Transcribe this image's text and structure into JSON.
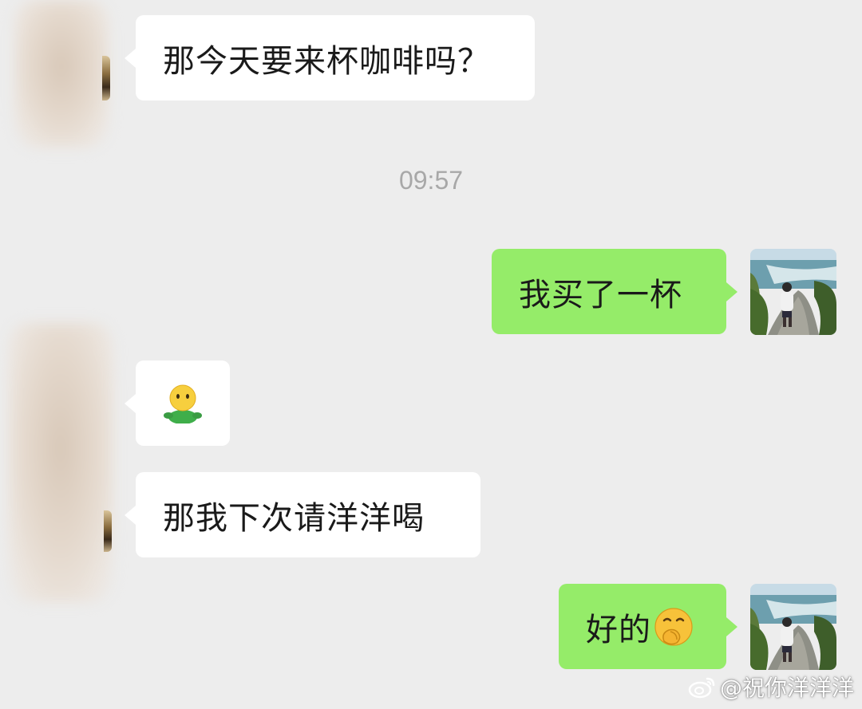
{
  "messages": [
    {
      "id": 1,
      "side": "received",
      "text": "那今天要来杯咖啡吗？"
    },
    {
      "id": 2,
      "side": "sent",
      "text": "我买了一杯"
    },
    {
      "id": 3,
      "side": "received",
      "emoji": "person-shrug-sticker"
    },
    {
      "id": 4,
      "side": "received",
      "text": "那我下次请洋洋喝"
    },
    {
      "id": 5,
      "side": "sent",
      "text": "好的",
      "emoji": "hand-over-mouth-emoji"
    }
  ],
  "timestamp": "09:57",
  "watermark": {
    "icon": "weibo-icon",
    "text": "@祝你洋洋洋"
  },
  "colors": {
    "background": "#ededed",
    "received_bubble": "#ffffff",
    "sent_bubble": "#95ec69",
    "timestamp": "#a8a8a8"
  }
}
